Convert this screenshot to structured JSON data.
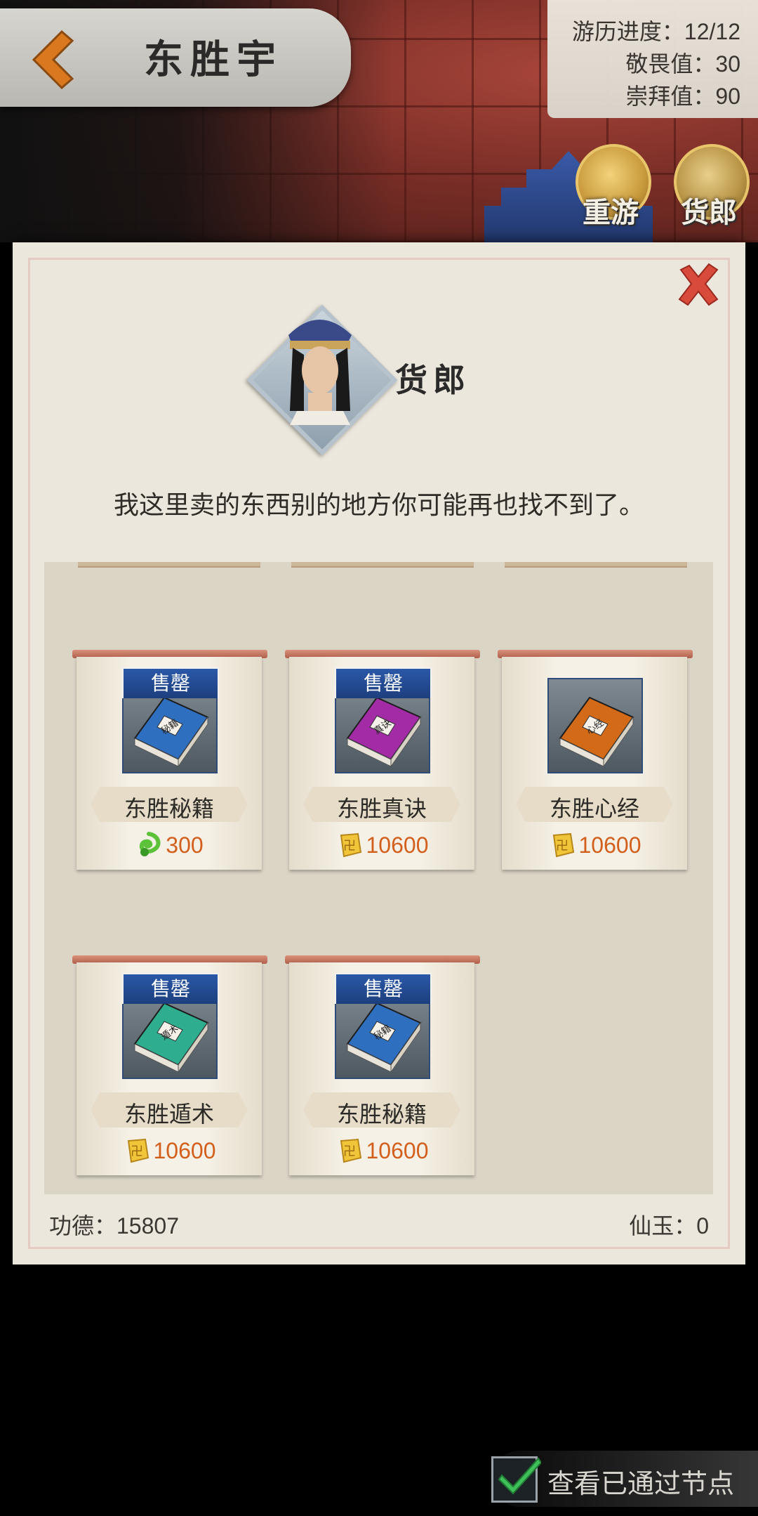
{
  "header": {
    "title": "东胜宇",
    "stats": {
      "progress": "游历进度：12/12",
      "awe": "敬畏值：30",
      "worship": "崇拜值：90"
    },
    "nodes": {
      "revisit_label": "重游",
      "merchant_label": "货郎"
    }
  },
  "dialog": {
    "npc_name": "货郎",
    "dialogue": "我这里卖的东西别的地方你可能再也找不到了。",
    "items": [
      {
        "name": "东胜秘籍",
        "price": "300",
        "currency_icon": "green-dragon-jade-icon",
        "sold_out": true,
        "sold_out_label": "售罄",
        "book_color": "#2f6fc0",
        "book_title": "秘籍"
      },
      {
        "name": "东胜真诀",
        "price": "10600",
        "currency_icon": "gold-coin-icon",
        "sold_out": true,
        "sold_out_label": "售罄",
        "book_color": "#a32ca6",
        "book_title": "真诀"
      },
      {
        "name": "东胜心经",
        "price": "10600",
        "currency_icon": "gold-coin-icon",
        "sold_out": false,
        "book_color": "#d26a17",
        "book_title": "心经"
      },
      {
        "name": "东胜遁术",
        "price": "10600",
        "currency_icon": "gold-coin-icon",
        "sold_out": true,
        "sold_out_label": "售罄",
        "book_color": "#2fae8f",
        "book_title": "遁术"
      },
      {
        "name": "东胜秘籍",
        "price": "10600",
        "currency_icon": "gold-coin-icon",
        "sold_out": true,
        "sold_out_label": "售罄",
        "book_color": "#2f6fc0",
        "book_title": "秘籍"
      }
    ],
    "footer": {
      "merit": "功德：15807",
      "jade": "仙玉：0"
    }
  },
  "toggle": {
    "label": "查看已通过节点",
    "checked": true
  },
  "colors": {
    "accent_price": "#d35f1c",
    "close_red": "#d84a3a",
    "soldout_blue": "#1d3f7e"
  }
}
